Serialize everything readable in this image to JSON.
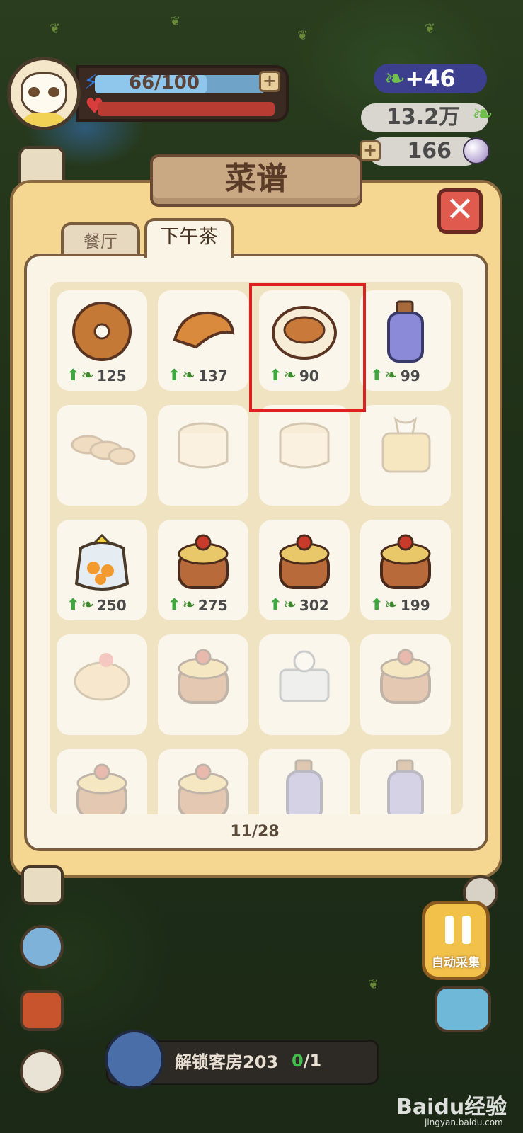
{
  "hud": {
    "energy": "66/100",
    "energy_fraction": 0.66,
    "gain": "+46",
    "bamboo_total": "13.2万",
    "pearls": "166",
    "plus_label": "+"
  },
  "panel": {
    "title": "菜谱",
    "close_label": "✕",
    "tabs": [
      {
        "label": "餐厅"
      },
      {
        "label": "下午茶"
      }
    ],
    "pager": "11/28"
  },
  "items": [
    {
      "name": "donut",
      "value": "125",
      "locked": false,
      "art": "donut-icon"
    },
    {
      "name": "croissant",
      "value": "137",
      "locked": false,
      "art": "croissant-icon"
    },
    {
      "name": "egg-tart",
      "value": "90",
      "locked": false,
      "art": "egg-tart-icon",
      "highlighted": true
    },
    {
      "name": "juice-bottle",
      "value": "99",
      "locked": false,
      "art": "bottle-icon"
    },
    {
      "name": "baguettes",
      "value": "",
      "locked": true,
      "art": "baguettes-icon"
    },
    {
      "name": "pudding",
      "value": "",
      "locked": true,
      "art": "pudding-icon"
    },
    {
      "name": "blueberry-pudding",
      "value": "",
      "locked": true,
      "art": "pudding-icon"
    },
    {
      "name": "bread-loaf",
      "value": "",
      "locked": true,
      "art": "loaf-icon"
    },
    {
      "name": "cookie-bag",
      "value": "250",
      "locked": false,
      "art": "cookie-bag-icon"
    },
    {
      "name": "orange-cake",
      "value": "275",
      "locked": false,
      "art": "cake-icon"
    },
    {
      "name": "chocolate-cake",
      "value": "302",
      "locked": false,
      "art": "cake-icon"
    },
    {
      "name": "red-velvet-cake",
      "value": "199",
      "locked": false,
      "art": "cake-icon"
    },
    {
      "name": "strawberry-roll",
      "value": "",
      "locked": true,
      "art": "roll-icon"
    },
    {
      "name": "mango-cake",
      "value": "",
      "locked": true,
      "art": "cake-icon"
    },
    {
      "name": "blueberry-mousse",
      "value": "",
      "locked": true,
      "art": "mousse-icon"
    },
    {
      "name": "lemon-cake",
      "value": "",
      "locked": true,
      "art": "cake-icon"
    },
    {
      "name": "choco-cream-cake",
      "value": "",
      "locked": true,
      "art": "cake-icon"
    },
    {
      "name": "berry-cake",
      "value": "",
      "locked": true,
      "art": "cake-icon"
    },
    {
      "name": "lemon-juice",
      "value": "",
      "locked": true,
      "art": "bottle-icon"
    },
    {
      "name": "berry-juice",
      "value": "",
      "locked": true,
      "art": "bottle-icon"
    }
  ],
  "bottom": {
    "quest_label": "解锁客房203",
    "quest_progress_current": "0",
    "quest_progress_total": "/1",
    "auto_label": "自动采集"
  },
  "watermark": "Baidu经验",
  "watermark_sub": "jingyan.baidu.com",
  "colors": {
    "panel": "#f6d792",
    "highlight": "#e02020",
    "progress_current": "#3fbf4a"
  }
}
